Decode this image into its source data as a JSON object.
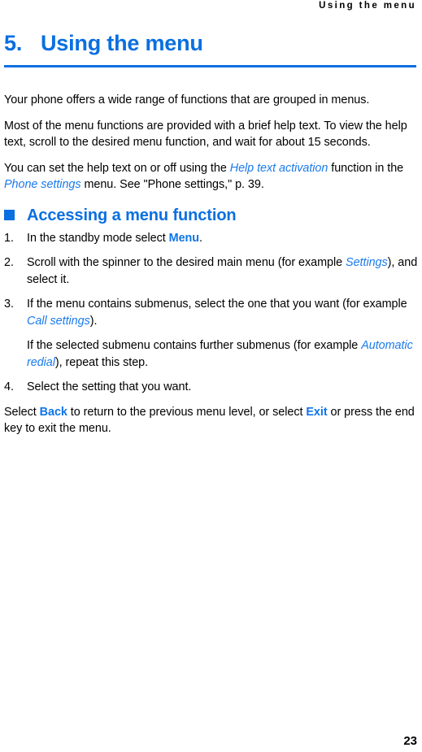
{
  "running_header": "Using the menu",
  "chapter": {
    "number": "5.",
    "title": "Using the menu"
  },
  "intro": {
    "para1": "Your phone offers a wide range of functions that are grouped in menus.",
    "para2": "Most of the menu functions are provided with a brief help text. To view the help text, scroll to the desired menu function, and wait for about 15 seconds.",
    "para3_part1": "You can set the help text on or off using the ",
    "para3_term1": "Help text activation",
    "para3_part2": " function in the ",
    "para3_term2": "Phone settings",
    "para3_part3": " menu. See \"Phone settings,\" p. 39."
  },
  "section": {
    "bullet_icon": "square-bullet-icon",
    "heading": "Accessing a menu function"
  },
  "steps": [
    {
      "number": "1.",
      "part1": "In the standby mode select ",
      "keyword": "Menu",
      "part2": "."
    },
    {
      "number": "2.",
      "part1": "Scroll with the spinner to the desired main menu (for example ",
      "keyword": "Settings",
      "part2": "), and select it."
    },
    {
      "number": "3.",
      "part1": "If the menu contains submenus, select the one that you want (for example ",
      "keyword": "Call settings",
      "part2": ").",
      "sub_part1": "If the selected submenu contains further submenus (for example ",
      "sub_keyword": "Automatic redial",
      "sub_part2": "), repeat this step."
    },
    {
      "number": "4.",
      "part1": "Select the setting that you want.",
      "keyword": "",
      "part2": ""
    }
  ],
  "closing": {
    "part1": "Select ",
    "keyword1": "Back",
    "part2": " to return to the previous menu level, or select ",
    "keyword2": "Exit",
    "part3": " or press the end key to exit the menu."
  },
  "page_number": "23",
  "colors": {
    "accent_blue": "#0a6fe0",
    "inline_blue": "#1a7aed",
    "text_black": "#000000",
    "background": "#ffffff"
  }
}
